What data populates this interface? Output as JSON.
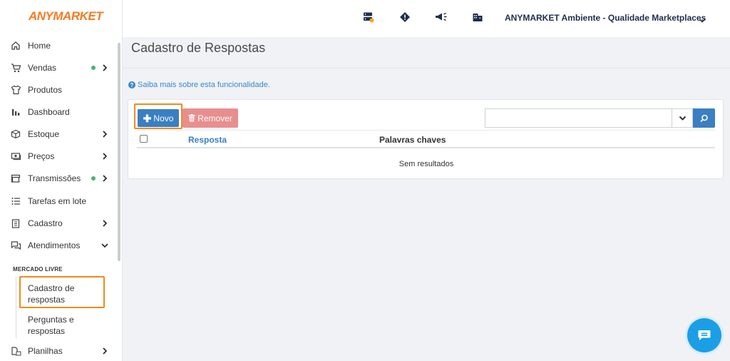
{
  "brand": {
    "logo": "ANYMARKET"
  },
  "topbar": {
    "account_name": "ANYMARKET Ambiente - Qualidade Marketplaces"
  },
  "page": {
    "title": "Cadastro de Respostas",
    "help_text": "Saiba mais sobre esta funcionalidade."
  },
  "toolbar": {
    "new_label": "Novo",
    "remove_label": "Remover",
    "search_value": ""
  },
  "table": {
    "columns": [
      "Resposta",
      "Palavras chaves"
    ],
    "empty_text": "Sem resultados"
  },
  "sidebar": {
    "items": [
      {
        "label": "Home",
        "icon": "home-icon"
      },
      {
        "label": "Vendas",
        "icon": "cart-icon",
        "dot": true,
        "chevron": "right"
      },
      {
        "label": "Produtos",
        "icon": "shirt-icon"
      },
      {
        "label": "Dashboard",
        "icon": "bar-chart-icon"
      },
      {
        "label": "Estoque",
        "icon": "box-icon",
        "chevron": "right"
      },
      {
        "label": "Preços",
        "icon": "money-icon",
        "chevron": "right"
      },
      {
        "label": "Transmissões",
        "icon": "store-icon",
        "dot": true,
        "chevron": "right"
      },
      {
        "label": "Tarefas em lote",
        "icon": "list-icon"
      },
      {
        "label": "Cadastro",
        "icon": "clipboard-icon",
        "chevron": "right"
      },
      {
        "label": "Atendimentos",
        "icon": "chat-icon",
        "chevron": "down"
      }
    ],
    "section_title": "MERCADO LIVRE",
    "sub_items": [
      "Cadastro de respostas",
      "Perguntas e respostas"
    ],
    "last_item": {
      "label": "Planilhas",
      "icon": "spreadsheet-icon",
      "chevron": "right"
    }
  },
  "colors": {
    "accent": "#3a7fc1",
    "brand": "#f47b20",
    "highlight": "#f08a1c",
    "danger": "#e98e8e",
    "status_dot": "#4caf7d"
  }
}
